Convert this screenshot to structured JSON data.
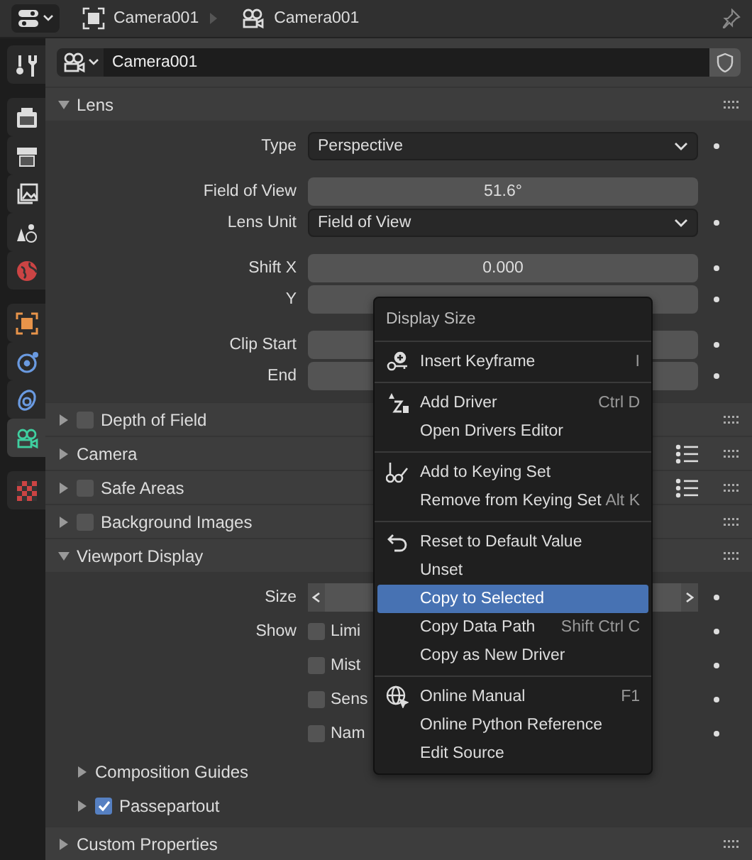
{
  "header": {
    "breadcrumbs": [
      {
        "kind": "object",
        "label": "Camera001"
      },
      {
        "kind": "camera",
        "label": "Camera001"
      }
    ]
  },
  "sidebar": {
    "tab_groups": [
      [
        {
          "kind": "tool",
          "selected": false
        }
      ],
      [
        {
          "kind": "render",
          "selected": false
        },
        {
          "kind": "output",
          "selected": false
        },
        {
          "kind": "view_layer",
          "selected": false
        },
        {
          "kind": "scene",
          "selected": false
        },
        {
          "kind": "world",
          "selected": false
        }
      ],
      [
        {
          "kind": "object",
          "selected": false
        },
        {
          "kind": "physics",
          "selected": false
        },
        {
          "kind": "constraints",
          "selected": false
        },
        {
          "kind": "data",
          "selected": true
        }
      ],
      [
        {
          "kind": "texture",
          "selected": false
        }
      ]
    ]
  },
  "datablock": {
    "name": "Camera001"
  },
  "panels": [
    {
      "title": "Lens",
      "expanded": true,
      "groups": [
        [
          {
            "kind": "dropdown",
            "label": "Type",
            "value": "Perspective",
            "animatable": true
          }
        ],
        [
          {
            "kind": "number",
            "label": "Field of View",
            "value": "51.6°"
          },
          {
            "kind": "dropdown",
            "label": "Lens Unit",
            "value": "Field of View",
            "animatable": true
          }
        ],
        [
          {
            "kind": "number",
            "label": "Shift X",
            "value": "0.000",
            "animatable": true
          },
          {
            "kind": "number",
            "label": "Y",
            "animatable": true
          }
        ],
        [
          {
            "kind": "number",
            "label": "Clip Start",
            "animatable": true
          },
          {
            "kind": "number",
            "label": "End",
            "animatable": true
          }
        ]
      ]
    },
    {
      "title": "Depth of Field",
      "expanded": false,
      "checkbox": true,
      "checked": false
    },
    {
      "title": "Camera",
      "expanded": false,
      "list_icon": true
    },
    {
      "title": "Safe Areas",
      "expanded": false,
      "checkbox": true,
      "checked": false,
      "list_icon": true
    },
    {
      "title": "Background Images",
      "expanded": false,
      "checkbox": true,
      "checked": false
    },
    {
      "title": "Viewport Display",
      "expanded": true,
      "groups": [
        [
          {
            "kind": "arrows",
            "label": "Size",
            "animatable": true
          },
          {
            "kind": "checkbox",
            "label": "Show",
            "text": "Limi",
            "checked": false,
            "animatable": true
          },
          {
            "kind": "checkbox",
            "text": "Mist",
            "checked": false,
            "animatable": true
          },
          {
            "kind": "checkbox",
            "text": "Sens",
            "checked": false,
            "animatable": true
          },
          {
            "kind": "checkbox",
            "text": "Nam",
            "checked": false,
            "animatable": true
          }
        ]
      ],
      "subpanels": [
        {
          "title": "Composition Guides",
          "expanded": false
        },
        {
          "title": "Passepartout",
          "expanded": false,
          "checkbox": true,
          "checked": true
        }
      ]
    },
    {
      "title": "Custom Properties",
      "expanded": false
    }
  ],
  "menu": {
    "title": "Display Size",
    "sections": [
      [
        {
          "kind": "keyframe",
          "label": "Insert Keyframe",
          "shortcut": "I",
          "selected": false
        }
      ],
      [
        {
          "kind": "driver",
          "label": "Add Driver",
          "shortcut": "Ctrl D",
          "selected": false
        },
        {
          "label": "Open Drivers Editor",
          "selected": false
        }
      ],
      [
        {
          "kind": "keying_set",
          "label": "Add to Keying Set",
          "selected": false
        },
        {
          "label": "Remove from Keying Set",
          "shortcut": "Alt K",
          "selected": false
        }
      ],
      [
        {
          "kind": "reset",
          "label": "Reset to Default Value",
          "selected": false
        },
        {
          "label": "Unset",
          "selected": false
        },
        {
          "label": "Copy to Selected",
          "selected": true
        },
        {
          "label": "Copy Data Path",
          "shortcut": "Shift Ctrl C",
          "selected": false
        },
        {
          "label": "Copy as New Driver",
          "selected": false
        }
      ],
      [
        {
          "kind": "globe",
          "label": "Online Manual",
          "shortcut": "F1",
          "selected": false
        },
        {
          "label": "Online Python Reference",
          "selected": false
        },
        {
          "label": "Edit Source",
          "selected": false
        }
      ]
    ]
  }
}
